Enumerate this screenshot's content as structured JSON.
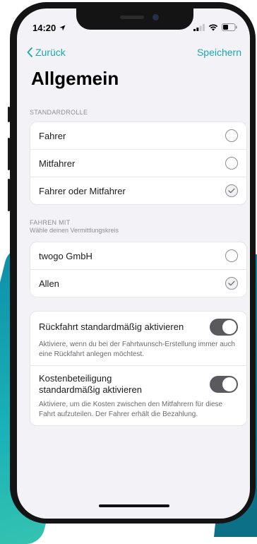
{
  "status_bar": {
    "time": "14:20"
  },
  "nav": {
    "back_label": "Zurück",
    "save_label": "Speichern"
  },
  "page": {
    "title": "Allgemein"
  },
  "standardrolle": {
    "header": "STANDARDROLLE",
    "options": [
      {
        "label": "Fahrer",
        "selected": false
      },
      {
        "label": "Mitfahrer",
        "selected": false
      },
      {
        "label": "Fahrer oder Mitfahrer",
        "selected": true
      }
    ]
  },
  "fahren_mit": {
    "header": "FAHREN MIT",
    "subheader": "Wähle deinen Vermittlungskreis",
    "options": [
      {
        "label": "twogo GmbH",
        "selected": false
      },
      {
        "label": "Allen",
        "selected": true
      }
    ]
  },
  "toggles": [
    {
      "label": "Rückfahrt standardmäßig aktivieren",
      "description": "Aktiviere, wenn du bei der Fahrtwunsch-Erstellung immer auch eine Rückfahrt anlegen möchtest.",
      "on": true
    },
    {
      "label": "Kostenbeteiligung standardmäßig aktivieren",
      "description": "Aktiviere, um die Kosten zwischen den Mitfahrern für diese Fahrt aufzuteilen. Der Fahrer erhält die Bezahlung.",
      "on": true
    }
  ],
  "colors": {
    "accent": "#1aa9b0",
    "toggle_on": "#5a5a5e",
    "background": "#f2f2f7"
  }
}
